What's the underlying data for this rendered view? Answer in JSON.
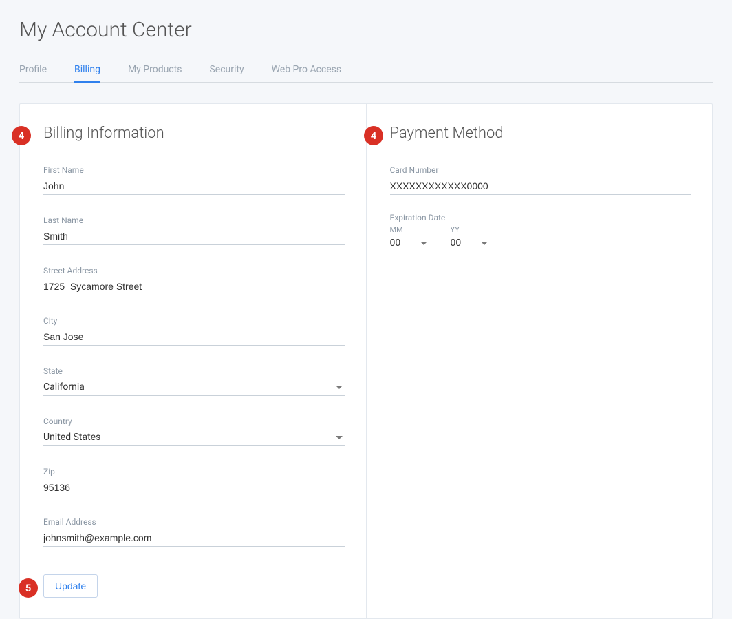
{
  "pageTitle": "My Account Center",
  "tabs": [
    {
      "label": "Profile",
      "active": false
    },
    {
      "label": "Billing",
      "active": true
    },
    {
      "label": "My Products",
      "active": false
    },
    {
      "label": "Security",
      "active": false
    },
    {
      "label": "Web Pro Access",
      "active": false
    }
  ],
  "billing": {
    "sectionTitle": "Billing Information",
    "labels": {
      "firstName": "First Name",
      "lastName": "Last Name",
      "street": "Street Address",
      "city": "City",
      "state": "State",
      "country": "Country",
      "zip": "Zip",
      "email": "Email Address"
    },
    "values": {
      "firstName": "John",
      "lastName": "Smith",
      "street": "1725  Sycamore Street",
      "city": "San Jose",
      "state": "California",
      "country": "United States",
      "zip": "95136",
      "email": "johnsmith@example.com"
    },
    "updateLabel": "Update"
  },
  "payment": {
    "sectionTitle": "Payment Method",
    "labels": {
      "cardNumber": "Card Number",
      "expiration": "Expiration Date",
      "mm": "MM",
      "yy": "YY"
    },
    "values": {
      "cardNumber": "XXXXXXXXXXXX0000",
      "mm": "00",
      "yy": "00"
    }
  },
  "callouts": {
    "billingBadge": "4",
    "paymentBadge": "4",
    "updateBadge": "5"
  }
}
